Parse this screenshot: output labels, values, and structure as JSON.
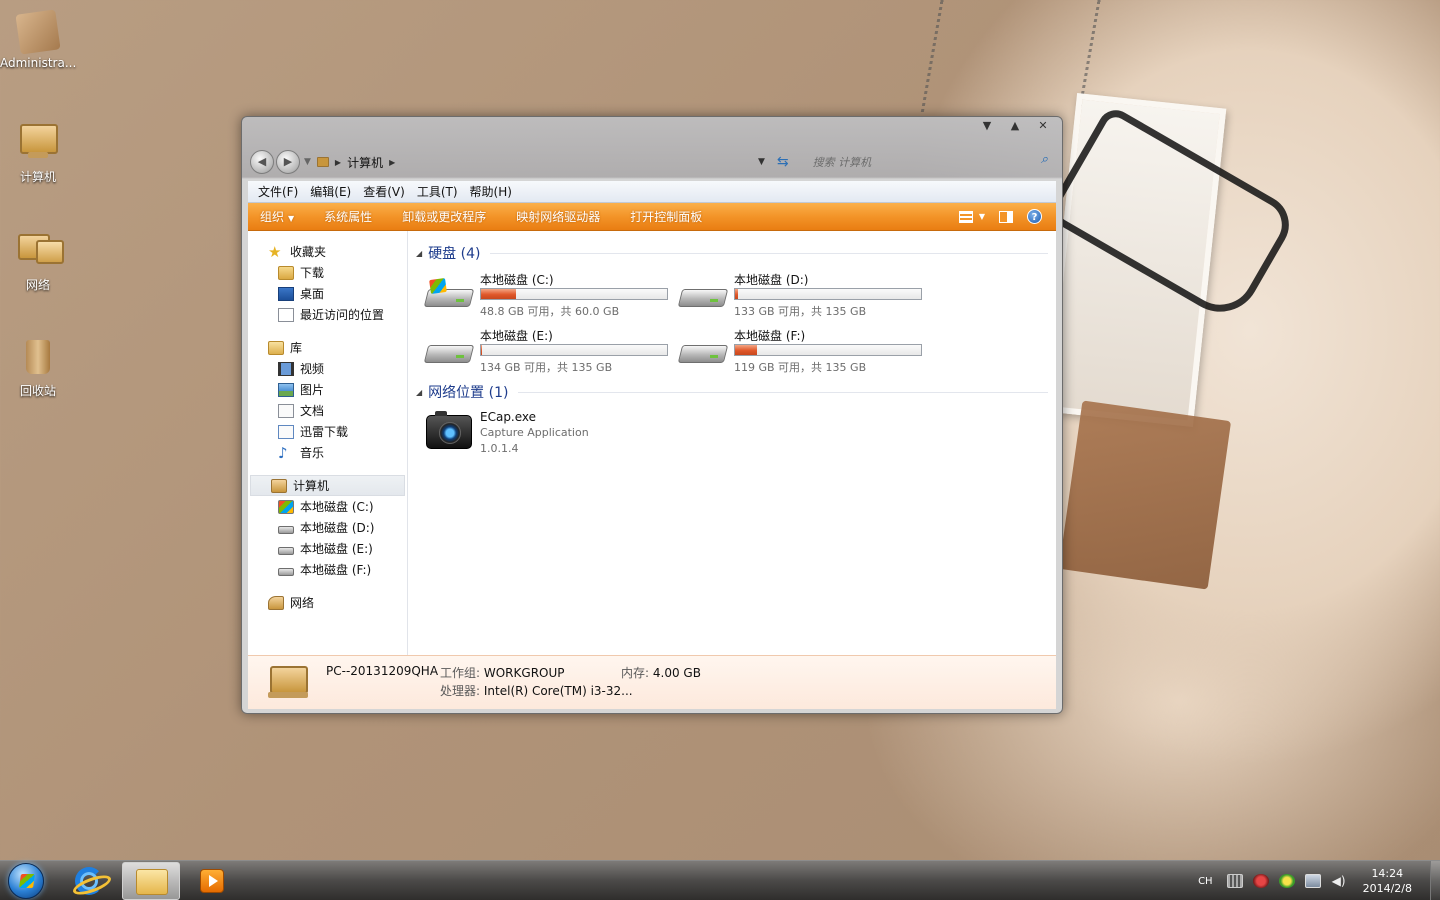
{
  "desktop": {
    "icons": [
      {
        "label": "Administra...",
        "icon": "user-folder-icon"
      },
      {
        "label": "计算机",
        "icon": "computer-icon"
      },
      {
        "label": "网络",
        "icon": "network-icon"
      },
      {
        "label": "回收站",
        "icon": "recycle-bin-icon"
      }
    ]
  },
  "window": {
    "address": {
      "crumb": "计算机",
      "search_placeholder": "搜索 计算机"
    },
    "menu": [
      "文件(F)",
      "编辑(E)",
      "查看(V)",
      "工具(T)",
      "帮助(H)"
    ],
    "commands": {
      "organize": "组织",
      "items": [
        "系统属性",
        "卸载或更改程序",
        "映射网络驱动器",
        "打开控制面板"
      ]
    },
    "nav": {
      "favorites": "收藏夹",
      "favorites_items": [
        "下载",
        "桌面",
        "最近访问的位置"
      ],
      "libraries": "库",
      "library_items": [
        "视频",
        "图片",
        "文档",
        "迅雷下载",
        "音乐"
      ],
      "computer": "计算机",
      "computer_items": [
        "本地磁盘 (C:)",
        "本地磁盘 (D:)",
        "本地磁盘 (E:)",
        "本地磁盘 (F:)"
      ],
      "network": "网络"
    },
    "groups": {
      "hard_disks": "硬盘 (4)",
      "network_locations": "网络位置 (1)"
    },
    "drives": [
      {
        "name": "本地磁盘 (C:)",
        "free": "48.8 GB 可用，共 60.0 GB",
        "used_fraction": 0.19,
        "system": true
      },
      {
        "name": "本地磁盘 (D:)",
        "free": "133 GB 可用，共 135 GB",
        "used_fraction": 0.015,
        "system": false
      },
      {
        "name": "本地磁盘 (E:)",
        "free": "134 GB 可用，共 135 GB",
        "used_fraction": 0.007,
        "system": false
      },
      {
        "name": "本地磁盘 (F:)",
        "free": "119 GB 可用，共 135 GB",
        "used_fraction": 0.12,
        "system": false
      }
    ],
    "network_item": {
      "name": "ECap.exe",
      "description": "Capture Application",
      "version": "1.0.1.4"
    },
    "details": {
      "pc_name": "PC--20131209QHA",
      "workgroup_label": "工作组:",
      "workgroup": "WORKGROUP",
      "memory_label": "内存:",
      "memory": "4.00 GB",
      "cpu_label": "处理器:",
      "cpu": "Intel(R) Core(TM) i3-32..."
    }
  },
  "taskbar": {
    "lang": "CH",
    "time": "14:24",
    "date": "2014/2/8"
  }
}
